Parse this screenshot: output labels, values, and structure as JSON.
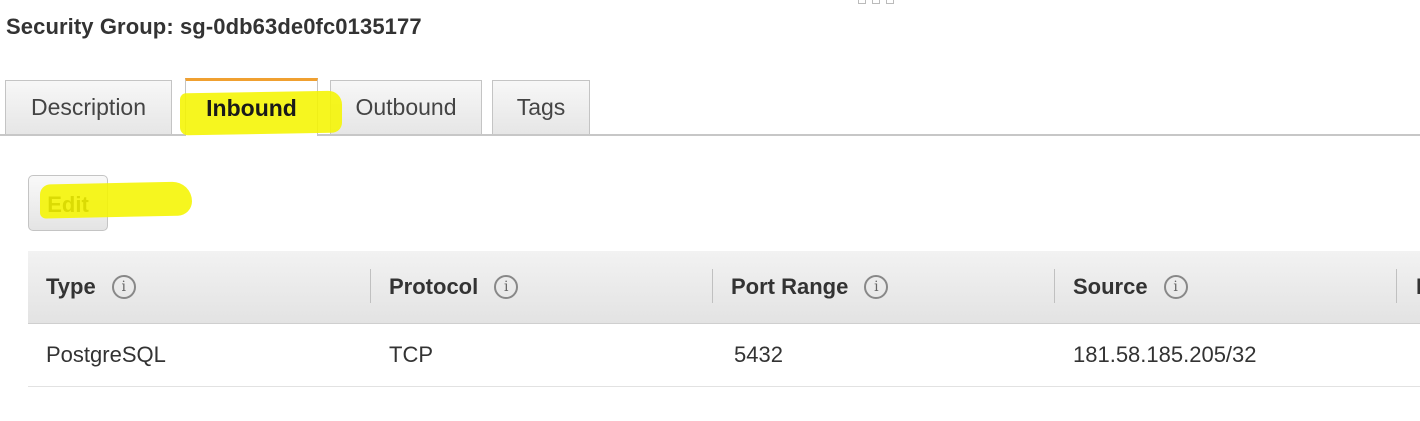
{
  "security_group": {
    "title": "Security Group: sg-0db63de0fc0135177"
  },
  "tabs": [
    {
      "label": "Description",
      "active": false
    },
    {
      "label": "Inbound",
      "active": true
    },
    {
      "label": "Outbound",
      "active": false
    },
    {
      "label": "Tags",
      "active": false
    }
  ],
  "actions": {
    "edit_label": "Edit"
  },
  "table": {
    "columns": [
      {
        "label": "Type",
        "icon": "info-icon"
      },
      {
        "label": "Protocol",
        "icon": "info-icon"
      },
      {
        "label": "Port Range",
        "icon": "info-icon"
      },
      {
        "label": "Source",
        "icon": "info-icon"
      },
      {
        "label": "D",
        "icon": null
      }
    ],
    "rows": [
      {
        "type": "PostgreSQL",
        "protocol": "TCP",
        "port_range": "5432",
        "source": "181.58.185.205/32"
      }
    ]
  },
  "colors": {
    "active_tab_accent": "#f0a030",
    "highlight": "#f5f500"
  }
}
